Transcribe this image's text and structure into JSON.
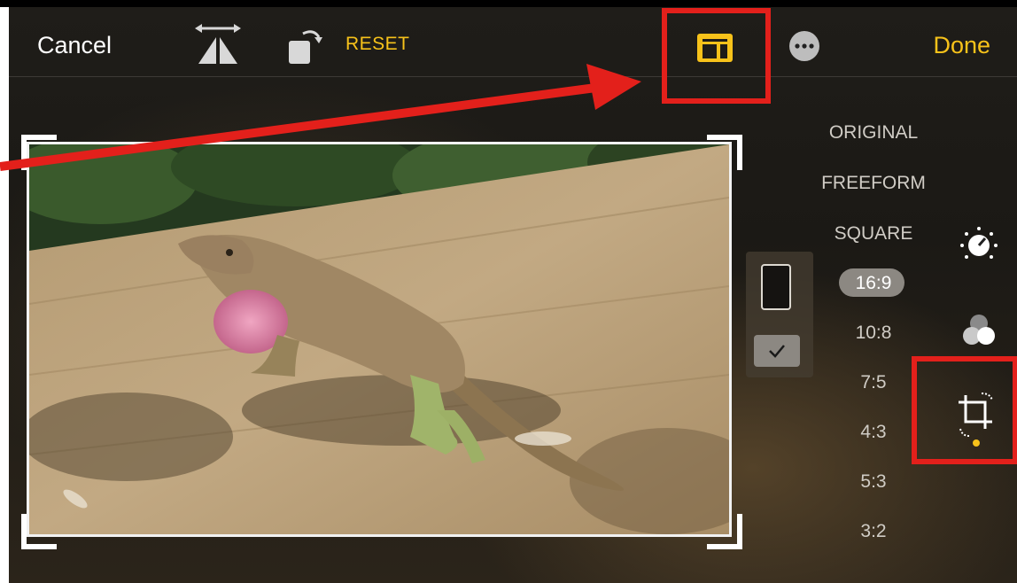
{
  "toolbar": {
    "cancel_label": "Cancel",
    "reset_label": "RESET",
    "done_label": "Done",
    "icons": [
      "flip-horizontal-icon",
      "rotate-icon",
      "aspect-ratio-icon",
      "more-icon"
    ]
  },
  "photo": {
    "subject": "anole-lizard-photo"
  },
  "aspect_ratios": {
    "options": [
      "ORIGINAL",
      "FREEFORM",
      "SQUARE",
      "16:9",
      "10:8",
      "7:5",
      "4:3",
      "5:3",
      "3:2"
    ],
    "selected": "16:9"
  },
  "orientation": {
    "icons": [
      "portrait-orientation-icon",
      "checkmark-icon"
    ]
  },
  "side_tools": {
    "icons": [
      "adjust-dial-icon",
      "filters-icon",
      "crop-rotate-icon"
    ]
  },
  "colors": {
    "accent": "#f7c21a",
    "annotation": "#e3201b",
    "background": "#1f1d19"
  }
}
